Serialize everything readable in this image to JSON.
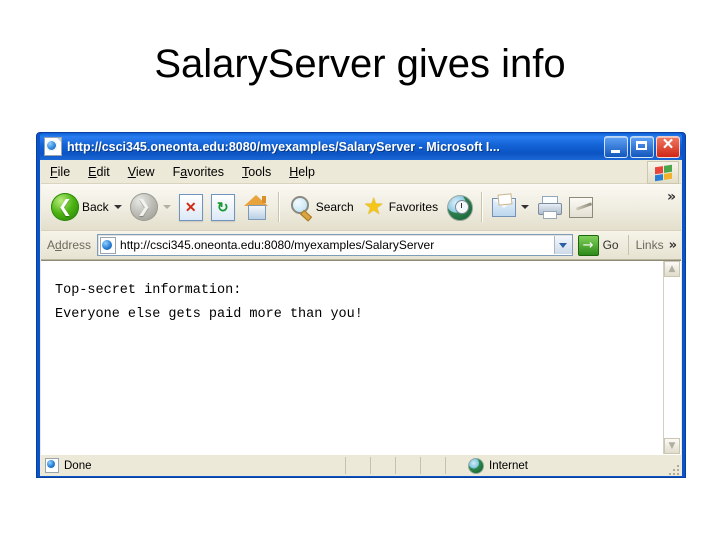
{
  "slide": {
    "title": "SalaryServer gives info"
  },
  "browser": {
    "window_title": "http://csci345.oneonta.edu:8080/myexamples/SalaryServer - Microsoft I...",
    "window_controls": {
      "minimize": "Minimize",
      "maximize": "Maximize",
      "close": "Close"
    },
    "menu": [
      {
        "label": "File",
        "accel": "F",
        "rest": "ile"
      },
      {
        "label": "Edit",
        "accel": "E",
        "rest": "dit"
      },
      {
        "label": "View",
        "accel": "V",
        "rest": "iew"
      },
      {
        "label": "Favorites",
        "accel": "a",
        "pre": "F",
        "rest": "vorites"
      },
      {
        "label": "Tools",
        "accel": "T",
        "rest": "ools"
      },
      {
        "label": "Help",
        "accel": "H",
        "rest": "elp"
      }
    ],
    "toolbar": {
      "back_label": "Back",
      "forward_label": "Forward",
      "stop_label": "Stop",
      "refresh_label": "Refresh",
      "home_label": "Home",
      "search_label": "Search",
      "favorites_label": "Favorites",
      "media_label": "Media",
      "mail_label": "Mail",
      "print_label": "Print",
      "edit_label": "Edit",
      "overflow_label": "»"
    },
    "address": {
      "label": "Address",
      "value": "http://csci345.oneonta.edu:8080/myexamples/SalaryServer",
      "placeholder": "Address",
      "go_label": "Go",
      "go_arrow": "→",
      "links_label": "Links",
      "overflow_label": "»"
    },
    "page": {
      "line1": "Top-secret information:",
      "line2": "Everyone else gets paid more than you!"
    },
    "scrollbar": {
      "up_arrow": "▲",
      "down_arrow": "▼"
    },
    "status": {
      "text": "Done",
      "zone": "Internet"
    }
  },
  "colors": {
    "titlebar_blue": "#0b61d6",
    "window_frame": "#0a54c8",
    "chrome_beige": "#ece9d8",
    "close_red": "#cf2716",
    "go_green": "#2d8a19",
    "back_green": "#4fb513",
    "star_gold": "#f5c518",
    "page_white": "#ffffff",
    "text_black": "#000000"
  }
}
